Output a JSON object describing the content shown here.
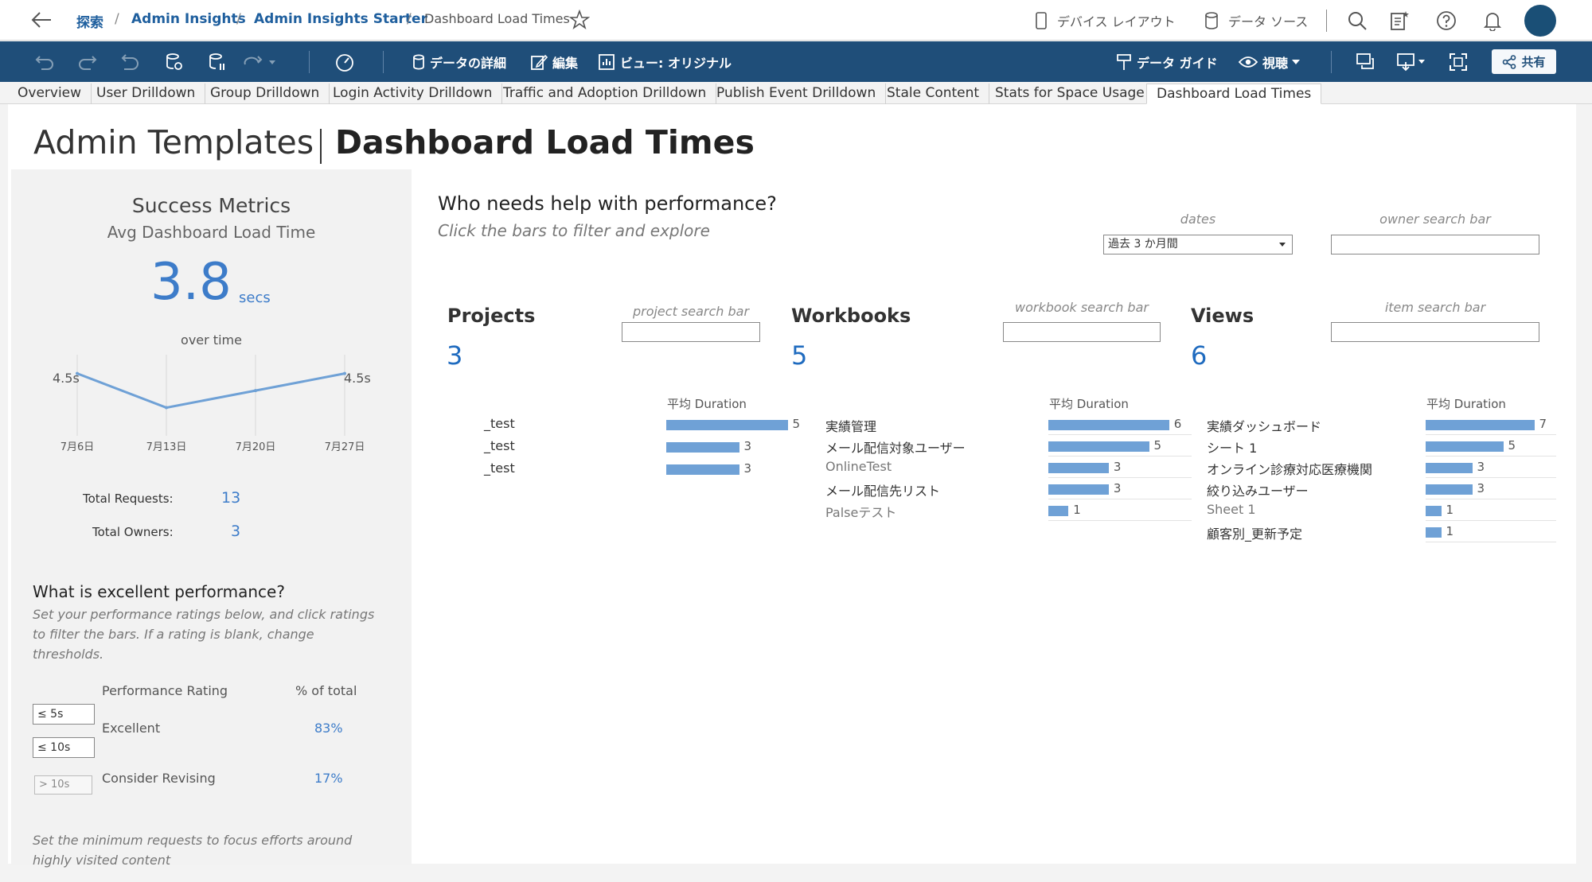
{
  "breadcrumb": {
    "items": [
      "探索",
      "Admin Insights",
      "Admin Insights Starter"
    ],
    "current": "Dashboard Load Times",
    "sep": "/"
  },
  "top_actions": {
    "device_layout": "デバイス レイアウト",
    "data_source": "データ ソース"
  },
  "toolbar": {
    "data_details": "データの詳細",
    "edit": "編集",
    "view_original": "ビュー: オリジナル",
    "data_guide": "データ ガイド",
    "watch": "視聴",
    "share": "共有"
  },
  "tabs": [
    "Overview",
    "User Drilldown",
    "Group Drilldown",
    "Login Activity Drilldown",
    "Traffic and Adoption Drilldown",
    "Publish Event Drilldown",
    "Stale Content",
    "Stats for Space Usage",
    "Dashboard Load Times"
  ],
  "active_tab": 8,
  "page": {
    "title_light": "Admin Templates",
    "title_bold": "Dashboard Load Times"
  },
  "success": {
    "heading": "Success Metrics",
    "subheading": "Avg Dashboard Load Time",
    "value": "3.8",
    "unit": "secs",
    "over_time_label": "over time",
    "first_label": "4.5s",
    "last_label": "4.5s",
    "total_requests_label": "Total Requests:",
    "total_requests": "13",
    "total_owners_label": "Total Owners:",
    "total_owners": "3"
  },
  "chart_data": {
    "type": "line",
    "title": "over time",
    "categories": [
      "7月6日",
      "7月13日",
      "7月20日",
      "7月27日"
    ],
    "values": [
      4.5,
      3.5,
      4.0,
      4.5
    ],
    "ylim": [
      3.0,
      5.0
    ],
    "grid": true,
    "color": "#6fa1d6"
  },
  "excellent": {
    "heading": "What is excellent performance?",
    "description": [
      "Set your performance ratings below, and click ratings",
      "to filter the bars. If a rating is blank, change",
      "thresholds."
    ],
    "col_rating": "Performance Rating",
    "col_pct": "% of total",
    "threshold1": "≤ 5s",
    "threshold2": "≤ 10s",
    "threshold3": "> 10s",
    "rows": [
      {
        "rating": "Excellent",
        "pct": "83%"
      },
      {
        "rating": "Consider Revising",
        "pct": "17%"
      }
    ],
    "footer": [
      "Set the minimum requests to focus efforts around",
      "highly visited content"
    ]
  },
  "help": {
    "heading": "Who needs help with performance?",
    "subheading": "Click the bars to filter and explore",
    "dates_label": "dates",
    "dates_value": "過去 3 か月間",
    "owner_search_label": "owner search bar"
  },
  "projects": {
    "title": "Projects",
    "count": "3",
    "search_label": "project search bar",
    "duration_label": "平均 Duration",
    "rows": [
      {
        "name": "_test",
        "value": 5
      },
      {
        "name": "_test",
        "value": 3
      },
      {
        "name": "_test",
        "value": 3
      }
    ]
  },
  "workbooks": {
    "title": "Workbooks",
    "count": "5",
    "search_label": "workbook search bar",
    "duration_label": "平均 Duration",
    "rows": [
      {
        "name": "実績管理",
        "value": 6
      },
      {
        "name": "メール配信対象ユーザー",
        "value": 5
      },
      {
        "name": "OnlineTest",
        "value": 3
      },
      {
        "name": "メール配信先リスト",
        "value": 3
      },
      {
        "name": "Palseテスト",
        "value": 1
      }
    ]
  },
  "views": {
    "title": "Views",
    "count": "6",
    "search_label": "item search bar",
    "duration_label": "平均 Duration",
    "rows": [
      {
        "name": "実績ダッシュボード",
        "value": 7
      },
      {
        "name": "シート 1",
        "value": 5
      },
      {
        "name": "オンライン診療対応医療機関",
        "value": 3
      },
      {
        "name": "絞り込みユーザー",
        "value": 3
      },
      {
        "name": "Sheet 1",
        "value": 1
      },
      {
        "name": "顧客別_更新予定",
        "value": 1
      }
    ]
  },
  "colors": {
    "toolbar": "#1f4e79",
    "link": "#1f5f9e",
    "accent": "#3d7cc9",
    "bar": "#6fa1d6"
  }
}
